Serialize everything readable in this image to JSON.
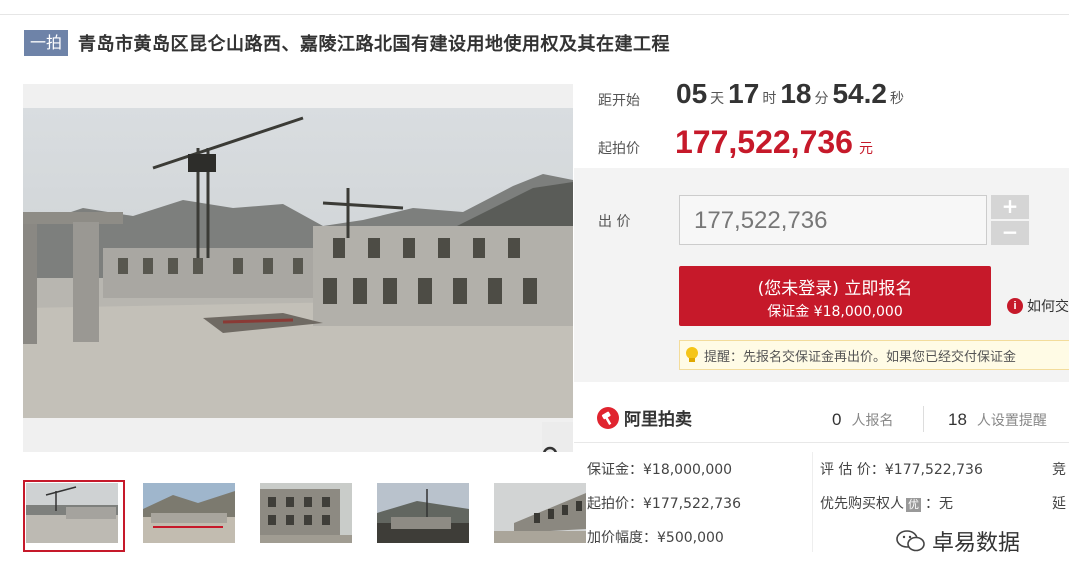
{
  "title": {
    "tag": "一拍",
    "text": "青岛市黄岛区昆仑山路西、嘉陵江路北国有建设用地使用权及其在建工程"
  },
  "countdown": {
    "label": "距开始",
    "days": "05",
    "days_unit": "天",
    "hours": "17",
    "hours_unit": "时",
    "minutes": "18",
    "minutes_unit": "分",
    "seconds": "54.2",
    "seconds_unit": "秒"
  },
  "start_price": {
    "label": "起拍价",
    "value": "177,522,736",
    "unit": "元"
  },
  "bid": {
    "label": "出 价",
    "input_value": "177,522,736",
    "plus": "+",
    "minus": "−"
  },
  "signup_button": {
    "main": "(您未登录) 立即报名",
    "sub": "保证金 ¥18,000,000"
  },
  "how_link": {
    "icon": "i",
    "text": "如何交"
  },
  "tip": {
    "text": "提醒：先报名交保证金再出价。如果您已经交付保证金"
  },
  "stats": {
    "brand": "阿里拍卖",
    "signups_num": "0",
    "signups_label": "人报名",
    "reminders_num": "18",
    "reminders_label": "人设置提醒"
  },
  "info": {
    "deposit": "保证金：¥18,000,000",
    "start_price": "起拍价：¥177,522,736",
    "increment": "加价幅度：¥500,000",
    "assessment": "评 估 价：¥177,522,736",
    "priority_label": "优先购买权人",
    "priority_tag": "优",
    "priority_value": "：无",
    "col3_row1": "竞",
    "col3_row2": "延"
  },
  "watermark": {
    "text": "卓易数据"
  },
  "colors": {
    "accent": "#c6192a",
    "tag_bg": "#6e83a8",
    "panel_bg": "#f3f3f3"
  }
}
